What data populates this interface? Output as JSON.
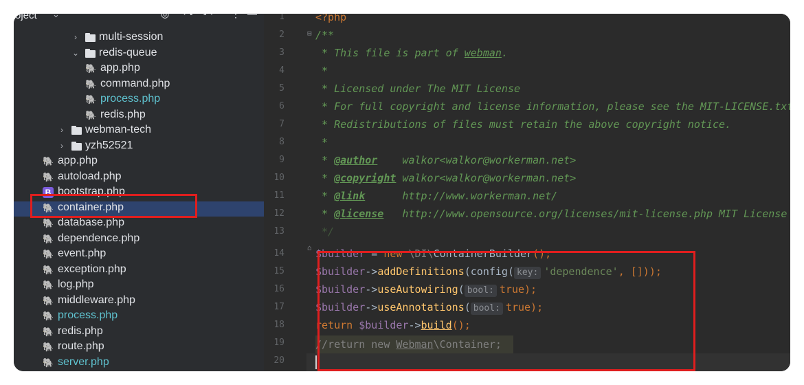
{
  "sidebar": {
    "header": {
      "title": "oject"
    },
    "rows": [
      {
        "indent": 2,
        "type": "folder",
        "arrow": ">",
        "label": "multi-session"
      },
      {
        "indent": 2,
        "type": "folder",
        "arrow": "v",
        "label": "redis-queue"
      },
      {
        "indent": 3,
        "type": "php",
        "label": "app.php"
      },
      {
        "indent": 3,
        "type": "php",
        "label": "command.php"
      },
      {
        "indent": 3,
        "type": "php",
        "label": "process.php",
        "teal": true
      },
      {
        "indent": 3,
        "type": "php",
        "label": "redis.php"
      },
      {
        "indent": 1,
        "type": "folder",
        "arrow": ">",
        "label": "webman-tech"
      },
      {
        "indent": 1,
        "type": "folder",
        "arrow": ">",
        "label": "yzh52521"
      },
      {
        "indent": 0,
        "type": "php",
        "label": "app.php"
      },
      {
        "indent": 0,
        "type": "php",
        "label": "autoload.php"
      },
      {
        "indent": 0,
        "type": "b",
        "label": "bootstrap.php"
      },
      {
        "indent": 0,
        "type": "php",
        "label": "container.php",
        "selected": true
      },
      {
        "indent": 0,
        "type": "php",
        "label": "database.php"
      },
      {
        "indent": 0,
        "type": "php",
        "label": "dependence.php"
      },
      {
        "indent": 0,
        "type": "php",
        "label": "event.php"
      },
      {
        "indent": 0,
        "type": "php",
        "label": "exception.php"
      },
      {
        "indent": 0,
        "type": "php",
        "label": "log.php"
      },
      {
        "indent": 0,
        "type": "php",
        "label": "middleware.php"
      },
      {
        "indent": 0,
        "type": "php",
        "label": "process.php",
        "teal": true
      },
      {
        "indent": 0,
        "type": "php",
        "label": "redis.php"
      },
      {
        "indent": 0,
        "type": "php",
        "label": "route.php"
      },
      {
        "indent": 0,
        "type": "php",
        "label": "server.php",
        "teal": true
      }
    ]
  },
  "editor": {
    "line_numbers": [
      "1",
      "2",
      "3",
      "4",
      "5",
      "6",
      "7",
      "8",
      "9",
      "10",
      "11",
      "12",
      "13",
      "14",
      "15",
      "16",
      "17",
      "18",
      "19",
      "20"
    ],
    "code": {
      "l1": "<?php",
      "l2": "/**",
      "l3a": " * This file is part of ",
      "l3b": "webman",
      "l3c": ".",
      "l4": " *",
      "l5": " * Licensed under The MIT License",
      "l6": " * For full copyright and license information, please see the MIT-LICENSE.txt",
      "l7": " * Redistributions of files must retain the above copyright notice.",
      "l8": " *",
      "l9a": " * ",
      "l9tag": "@author",
      "l9b": "    walkor<walkor@workerman.net>",
      "l10a": " * ",
      "l10tag": "@copyright",
      "l10b": " walkor<walkor@workerman.net>",
      "l11a": " * ",
      "l11tag": "@link",
      "l11b": "      http://www.workerman.net/",
      "l12a": " * ",
      "l12tag": "@license",
      "l12b": "   http://www.opensource.org/licenses/mit-license.php MIT License",
      "l13": " */",
      "l14var": "$builder",
      "l14op": " = ",
      "l14kw": "new",
      "l14ns": " \\DI\\",
      "l14cls": "ContainerBuilder",
      "l14p": "();",
      "l15var": "$builder",
      "l15arrow": "->",
      "l15fn": "addDefinitions",
      "l15p1": "(config(",
      "l15hint": "key:",
      "l15str": "'dependence'",
      "l15p2": ", []));",
      "l16var": "$builder",
      "l16arrow": "->",
      "l16fn": "useAutowiring",
      "l16p1": "(",
      "l16hint": "bool:",
      "l16kw": "true",
      "l16p2": ");",
      "l17var": "$builder",
      "l17arrow": "->",
      "l17fn": "useAnnotations",
      "l17p1": "(",
      "l17hint": "bool:",
      "l17kw": "true",
      "l17p2": ");",
      "l18kw": "return",
      "l18var": " $builder",
      "l18arrow": "->",
      "l18fn": "build",
      "l18p": "();",
      "l19a": "//return new ",
      "l19b": "Webman",
      "l19c": "\\Container;"
    }
  },
  "colors": {
    "highlight_box": "#e01e1e",
    "sidebar_bg": "#2b2d30",
    "editor_bg": "#2b2b2b",
    "selected_row": "#2e436e"
  }
}
